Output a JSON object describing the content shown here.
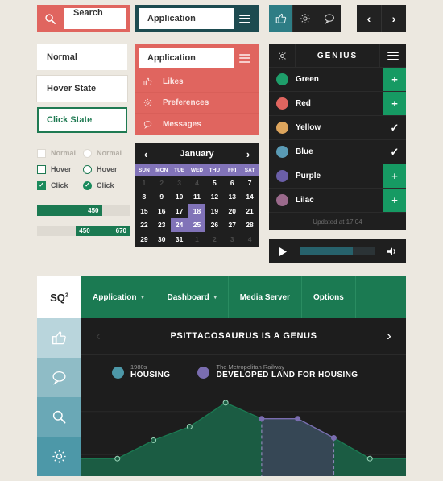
{
  "search": {
    "placeholder": "Search",
    "value": "Search",
    "icon": "search-icon",
    "bg": "#e0655f"
  },
  "text_fields": {
    "normal": "Normal",
    "hover": "Hover State",
    "click": "Click State"
  },
  "appbar_teal": {
    "value": "Application",
    "menu_icon": "hamburger-icon",
    "bg": "#1d4b50"
  },
  "app_menu": {
    "value": "Application",
    "menu_icon": "hamburger-icon",
    "bg": "#e0655f",
    "items": [
      {
        "label": "Likes",
        "icon": "thumbs-up-icon"
      },
      {
        "label": "Preferences",
        "icon": "gear-icon"
      },
      {
        "label": "Messages",
        "icon": "chat-bubble-icon"
      }
    ]
  },
  "icon_toolbar": {
    "items": [
      {
        "icon": "thumbs-up-icon",
        "active": true
      },
      {
        "icon": "gear-icon",
        "active": false
      },
      {
        "icon": "chat-bubble-icon",
        "active": false
      }
    ],
    "active_bg": "#2e7d85"
  },
  "pager": {
    "prev": "‹",
    "next": "›"
  },
  "genius": {
    "title": "GENIUS",
    "gear_icon": "gear-icon",
    "menu_icon": "hamburger-icon",
    "footer": "Updated at 17:04",
    "rows": [
      {
        "name": "Green",
        "color": "#1e9e6a",
        "action": "+",
        "action_type": "add"
      },
      {
        "name": "Red",
        "color": "#e0655f",
        "action": "+",
        "action_type": "add"
      },
      {
        "name": "Yellow",
        "color": "#dda55d",
        "action": "✓",
        "action_type": "check"
      },
      {
        "name": "Blue",
        "color": "#5a9bb5",
        "action": "✓",
        "action_type": "check"
      },
      {
        "name": "Purple",
        "color": "#6b5fa8",
        "action": "+",
        "action_type": "add"
      },
      {
        "name": "Lilac",
        "color": "#9b6a8c",
        "action": "+",
        "action_type": "add"
      }
    ]
  },
  "player": {
    "play_icon": "play-icon",
    "volume_icon": "volume-icon",
    "progress_percent": 70
  },
  "controls": {
    "checkbox": [
      {
        "label": "Normal",
        "state": "normal"
      },
      {
        "label": "Hover",
        "state": "hover"
      },
      {
        "label": "Click",
        "state": "click"
      }
    ],
    "radio": [
      {
        "label": "Normal",
        "state": "normal"
      },
      {
        "label": "Hover",
        "state": "hover"
      },
      {
        "label": "Click",
        "state": "click"
      }
    ]
  },
  "sliders": {
    "single": {
      "value": "450",
      "fill_percent": 70
    },
    "range": {
      "low": "450",
      "high": "670",
      "start_percent": 42,
      "end_percent": 100
    }
  },
  "calendar": {
    "month": "January",
    "prev": "‹",
    "next": "›",
    "dows": [
      "SUN",
      "MON",
      "TUE",
      "WED",
      "THU",
      "FRI",
      "SAT"
    ],
    "days": [
      {
        "n": "1",
        "mut": true
      },
      {
        "n": "2",
        "mut": true
      },
      {
        "n": "3",
        "mut": true
      },
      {
        "n": "4",
        "mut": true
      },
      {
        "n": "5"
      },
      {
        "n": "6"
      },
      {
        "n": "7"
      },
      {
        "n": "8"
      },
      {
        "n": "9"
      },
      {
        "n": "10"
      },
      {
        "n": "11"
      },
      {
        "n": "12"
      },
      {
        "n": "13"
      },
      {
        "n": "14"
      },
      {
        "n": "15"
      },
      {
        "n": "16"
      },
      {
        "n": "17"
      },
      {
        "n": "18",
        "sel": true
      },
      {
        "n": "19"
      },
      {
        "n": "20"
      },
      {
        "n": "21"
      },
      {
        "n": "22"
      },
      {
        "n": "23"
      },
      {
        "n": "24",
        "sel": true
      },
      {
        "n": "25",
        "sel": true
      },
      {
        "n": "26"
      },
      {
        "n": "27"
      },
      {
        "n": "28"
      },
      {
        "n": "29"
      },
      {
        "n": "30"
      },
      {
        "n": "31"
      },
      {
        "n": "1",
        "mut": true
      },
      {
        "n": "2",
        "mut": true
      },
      {
        "n": "3",
        "mut": true
      },
      {
        "n": "4",
        "mut": true
      }
    ]
  },
  "app": {
    "logo": "SQ",
    "logo_sup": "2",
    "nav": [
      {
        "label": "Application",
        "caret": "▾"
      },
      {
        "label": "Dashboard",
        "caret": "▾"
      },
      {
        "label": "Media Server",
        "caret": ""
      },
      {
        "label": "Options",
        "caret": ""
      }
    ],
    "sidebar": [
      {
        "icon": "thumbs-up-icon",
        "bg": "#b9d5dc"
      },
      {
        "icon": "chat-bubble-icon",
        "bg": "#8fbcc6"
      },
      {
        "icon": "search-icon",
        "bg": "#6aa8b6"
      },
      {
        "icon": "gear-icon",
        "bg": "#4d98a8"
      }
    ],
    "slide": {
      "title": "PSITTACOSAURUS IS A GENUS",
      "prev": "‹",
      "next": "›"
    },
    "legend": [
      {
        "sub": "1980s",
        "main": "HOUSING",
        "color": "#4d98a8"
      },
      {
        "sub": "The Metropolitan Railway",
        "main": "DEVELOPED LAND FOR HOUSING",
        "color": "#7a6db0"
      }
    ]
  },
  "chart_data": {
    "type": "area",
    "title": "PSITTACOSAURUS IS A GENUS",
    "xlabel": "",
    "ylabel": "",
    "ylim": [
      0,
      100
    ],
    "grid": true,
    "legend_position": "top",
    "x": [
      0,
      1,
      2,
      3,
      4,
      5,
      6,
      7,
      8,
      9
    ],
    "series": [
      {
        "name": "HOUSING",
        "color": "#1b7a52",
        "values": [
          22,
          22,
          45,
          62,
          92,
          72,
          72,
          48,
          22,
          22
        ]
      },
      {
        "name": "DEVELOPED LAND FOR HOUSING",
        "color": "#7a6db0",
        "highlight_x": [
          5,
          6,
          7
        ],
        "values": [
          72,
          72,
          48
        ]
      }
    ],
    "markers": true,
    "highlight_band": {
      "from": 5,
      "to": 7,
      "fill": "#3b4358"
    }
  }
}
